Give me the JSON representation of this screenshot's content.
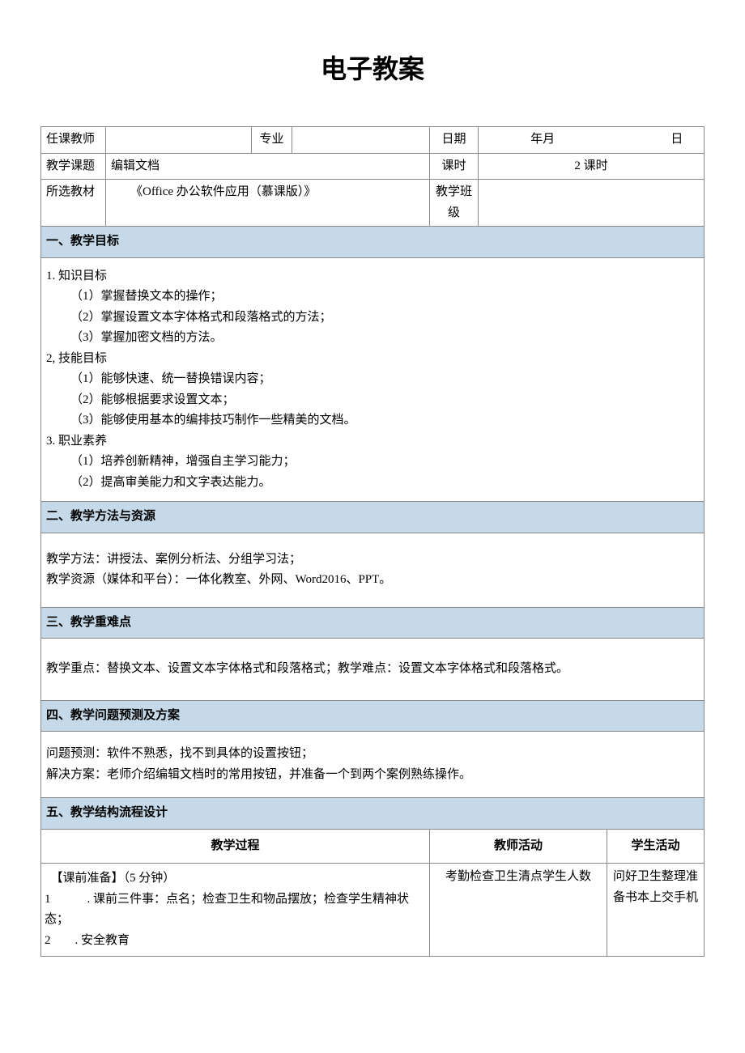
{
  "title": "电子教案",
  "header": {
    "labels": {
      "teacher": "任课教师",
      "major": "专业",
      "date": "日期",
      "topic": "教学课题",
      "hours": "课时",
      "textbook": "所选教材",
      "class": "教学班级"
    },
    "values": {
      "teacher": "",
      "major": "",
      "date_year_month": "年月",
      "date_day": "日",
      "topic": "编辑文档",
      "hours": "2 课时",
      "textbook": "《Office 办公软件应用（慕课版）》",
      "class": ""
    }
  },
  "sections": {
    "s1": {
      "title": "一、教学目标",
      "content": {
        "p1": "1. 知识目标",
        "p1_1": "（1）掌握替换文本的操作；",
        "p1_2": "（2）掌握设置文本字体格式和段落格式的方法；",
        "p1_3": "（3）掌握加密文档的方法。",
        "p2": "2, 技能目标",
        "p2_1": "（1）能够快速、统一替换错误内容；",
        "p2_2": "（2）能够根据要求设置文本；",
        "p2_3": "（3）能够使用基本的编排技巧制作一些精美的文档。",
        "p3": "3. 职业素养",
        "p3_1": "（1）培养创新精神，增强自主学习能力；",
        "p3_2": "（2）提高审美能力和文字表达能力。"
      }
    },
    "s2": {
      "title": "二、教学方法与资源",
      "content": {
        "l1": "教学方法：讲授法、案例分析法、分组学习法；",
        "l2": "教学资源（媒体和平台）：一体化教室、外网、Word2016、PPT。"
      }
    },
    "s3": {
      "title": "三、教学重难点",
      "content": {
        "l1": "教学重点：替换文本、设置文本字体格式和段落格式；教学难点：设置文本字体格式和段落格式。"
      }
    },
    "s4": {
      "title": "四、教学问题预测及方案",
      "content": {
        "l1": "问题预测：软件不熟悉，找不到具体的设置按钮；",
        "l2": "解决方案：老师介绍编辑文档时的常用按钮，并准备一个到两个案例熟练操作。"
      }
    },
    "s5": {
      "title": "五、教学结构流程设计",
      "columns": {
        "c1": "教学过程",
        "c2": "教师活动",
        "c3": "学生活动"
      },
      "row": {
        "process": {
          "l1": "　【课前准备】（5 分钟）",
          "l2": "1　　　. 课前三件事：点名；检查卫生和物品摆放；检查学生精神状态；",
          "l3": "2　　. 安全教育"
        },
        "teacher": "考勤检查卫生清点学生人数",
        "student": "问好卫生整理准备书本上交手机"
      }
    }
  }
}
